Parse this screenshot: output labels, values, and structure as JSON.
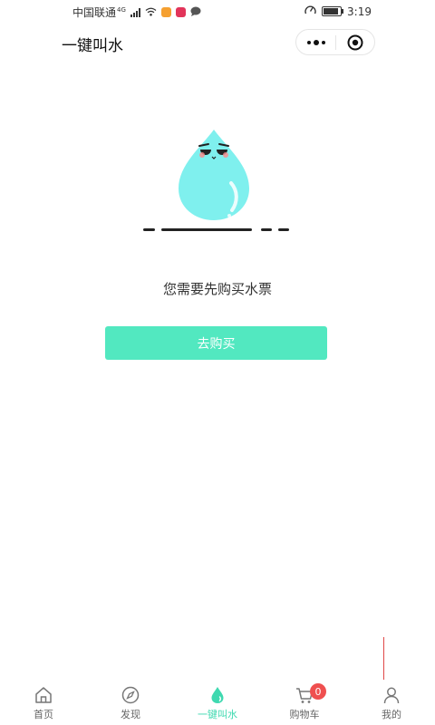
{
  "status_bar": {
    "carrier": "中国联通",
    "network": "4G",
    "time": "3:19"
  },
  "navbar": {
    "title": "一键叫水"
  },
  "main": {
    "message": "您需要先购买水票",
    "buy_button": "去购买"
  },
  "tabbar": {
    "items": [
      {
        "label": "首页",
        "icon": "home-icon"
      },
      {
        "label": "发现",
        "icon": "compass-icon"
      },
      {
        "label": "一键叫水",
        "icon": "water-drop-icon",
        "active": true
      },
      {
        "label": "购物车",
        "icon": "cart-icon",
        "badge": "0"
      },
      {
        "label": "我的",
        "icon": "user-icon"
      }
    ]
  },
  "colors": {
    "accent": "#52e8c0",
    "active_tab": "#3fd9b0",
    "badge": "#ef4f4f",
    "drop": "#7ff0ee"
  }
}
